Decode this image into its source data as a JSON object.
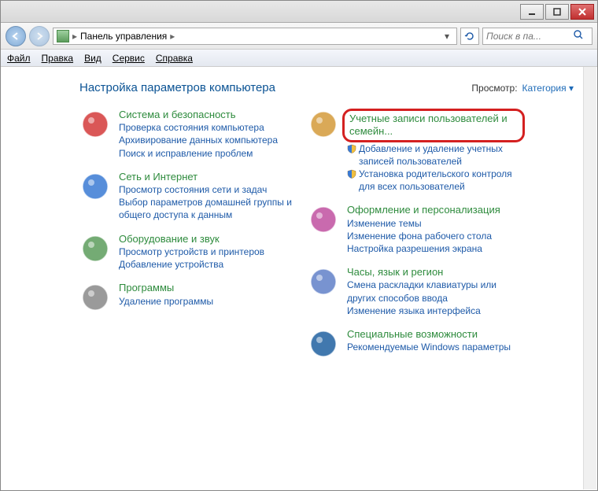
{
  "breadcrumb": {
    "label": "Панель управления"
  },
  "search": {
    "placeholder": "Поиск в па..."
  },
  "menu": {
    "file": "Файл",
    "edit": "Правка",
    "view": "Вид",
    "tools": "Сервис",
    "help": "Справка"
  },
  "heading": "Настройка параметров компьютера",
  "viewLabel": "Просмотр:",
  "viewValue": "Категория",
  "left": [
    {
      "title": "Система и безопасность",
      "links": [
        {
          "t": "Проверка состояния компьютера",
          "s": false
        },
        {
          "t": "Архивирование данных компьютера",
          "s": false
        },
        {
          "t": "Поиск и исправление проблем",
          "s": false
        }
      ]
    },
    {
      "title": "Сеть и Интернет",
      "links": [
        {
          "t": "Просмотр состояния сети и задач",
          "s": false
        },
        {
          "t": "Выбор параметров домашней группы и общего доступа к данным",
          "s": false
        }
      ]
    },
    {
      "title": "Оборудование и звук",
      "links": [
        {
          "t": "Просмотр устройств и принтеров",
          "s": false
        },
        {
          "t": "Добавление устройства",
          "s": false
        }
      ]
    },
    {
      "title": "Программы",
      "links": [
        {
          "t": "Удаление программы",
          "s": false
        }
      ]
    }
  ],
  "right": [
    {
      "title": "Учетные записи пользователей и семейн...",
      "highlight": true,
      "links": [
        {
          "t": "Добавление и удаление учетных записей пользователей",
          "s": true
        },
        {
          "t": "Установка родительского контроля для всех пользователей",
          "s": true
        }
      ]
    },
    {
      "title": "Оформление и персонализация",
      "links": [
        {
          "t": "Изменение темы",
          "s": false
        },
        {
          "t": "Изменение фона рабочего стола",
          "s": false
        },
        {
          "t": "Настройка разрешения экрана",
          "s": false
        }
      ]
    },
    {
      "title": "Часы, язык и регион",
      "links": [
        {
          "t": "Смена раскладки клавиатуры или других способов ввода",
          "s": false
        },
        {
          "t": "Изменение языка интерфейса",
          "s": false
        }
      ]
    },
    {
      "title": "Специальные возможности",
      "links": [
        {
          "t": "Рекомендуемые Windows параметры",
          "s": false
        }
      ]
    }
  ],
  "iconColors": {
    "left": [
      "#d43a3a",
      "#3a7ad4",
      "#5c9c5c",
      "#888888"
    ],
    "right": [
      "#d49a3a",
      "#c050a0",
      "#6080c8",
      "#2060a0"
    ]
  }
}
